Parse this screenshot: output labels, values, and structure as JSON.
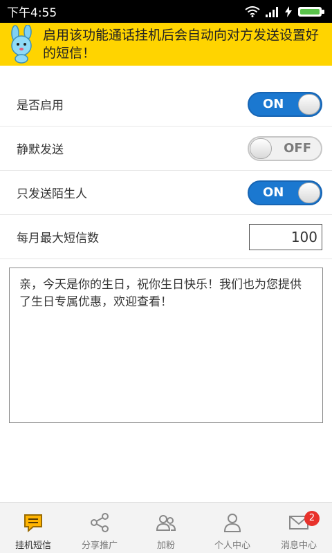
{
  "status_bar": {
    "time": "下午4:55"
  },
  "banner": {
    "text": "启用该功能通话挂机后会自动向对方发送设置好的短信！"
  },
  "settings": {
    "enable": {
      "label": "是否启用",
      "state": "ON"
    },
    "silent": {
      "label": "静默发送",
      "state": "OFF"
    },
    "strangers": {
      "label": "只发送陌生人",
      "state": "ON"
    },
    "monthly_max": {
      "label": "每月最大短信数",
      "value": "100"
    }
  },
  "message": {
    "text": "亲，今天是你的生日，祝你生日快乐！我们也为您提供了生日专属优惠，欢迎查看！"
  },
  "bottom_nav": {
    "items": [
      {
        "label": "挂机短信",
        "icon": "chat-icon",
        "active": true
      },
      {
        "label": "分享推广",
        "icon": "share-icon",
        "active": false
      },
      {
        "label": "加粉",
        "icon": "users-icon",
        "active": false
      },
      {
        "label": "个人中心",
        "icon": "person-icon",
        "active": false
      },
      {
        "label": "消息中心",
        "icon": "mail-icon",
        "active": false,
        "badge": "2"
      }
    ]
  },
  "colors": {
    "accent_yellow": "#ffd400",
    "toggle_on": "#1b78d0",
    "badge_red": "#e8322b"
  }
}
